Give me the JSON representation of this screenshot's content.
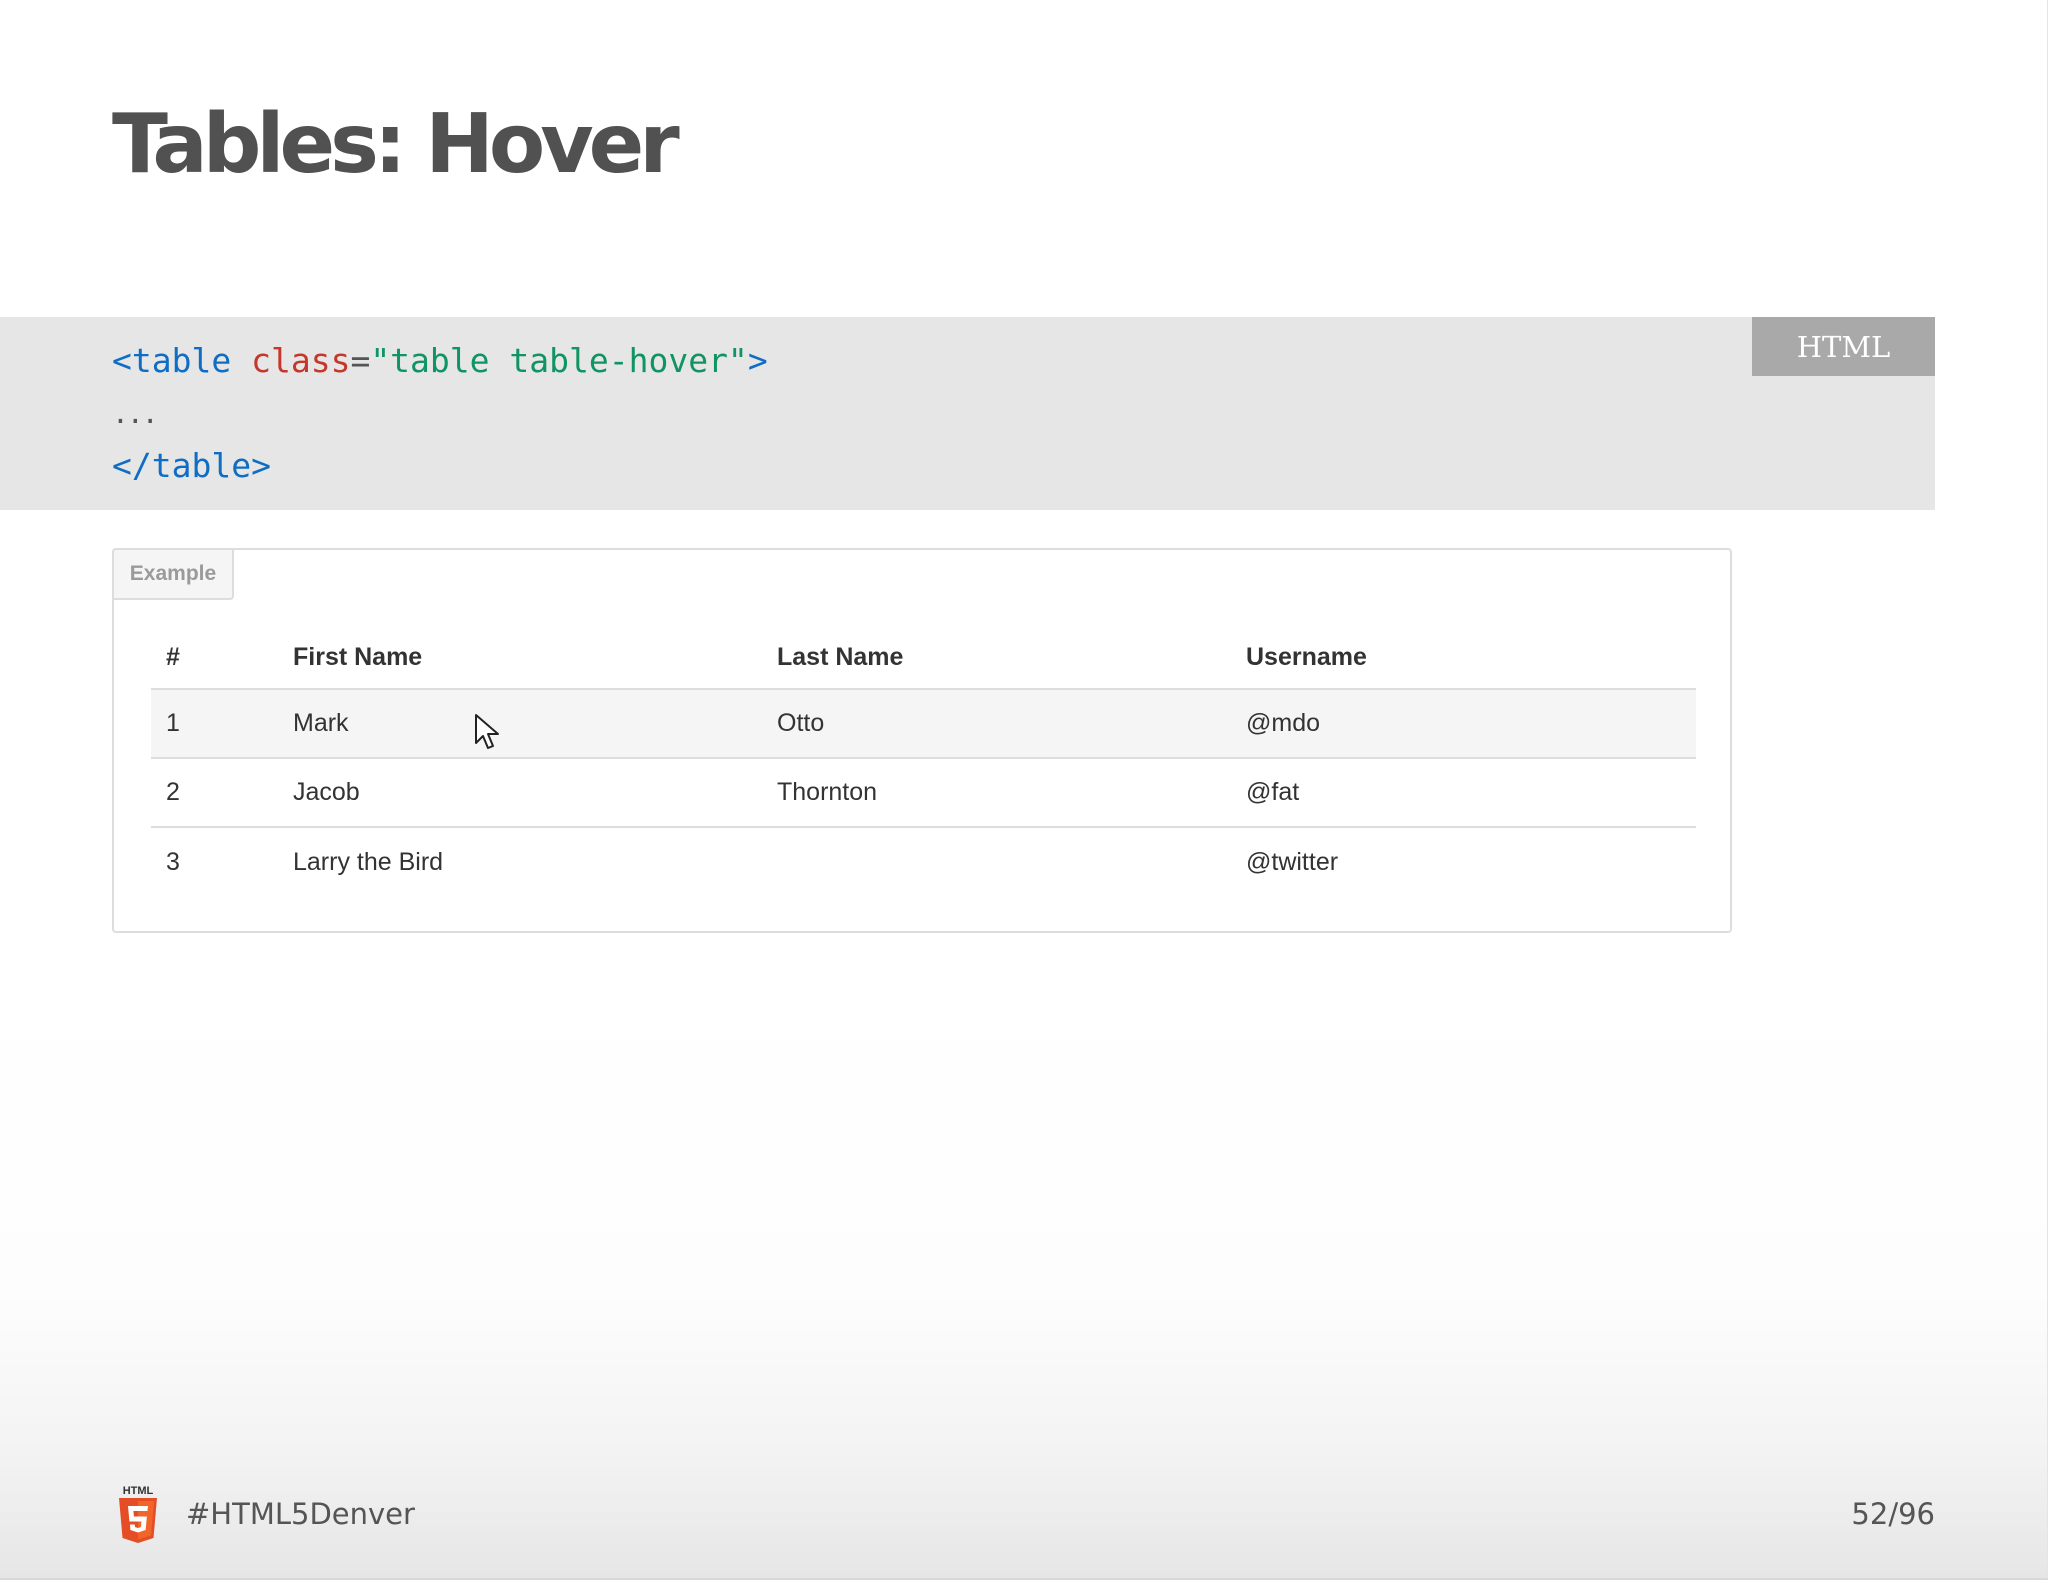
{
  "slide": {
    "title": "Tables: Hover",
    "code": {
      "language_badge": "HTML",
      "line1": {
        "open": "<table",
        "attr": "class",
        "eq": "=",
        "value": "\"table table-hover\"",
        "close": ">"
      },
      "line2": "...",
      "line3": "</table>"
    },
    "example": {
      "label": "Example",
      "columns": [
        "#",
        "First Name",
        "Last Name",
        "Username"
      ],
      "rows": [
        [
          "1",
          "Mark",
          "Otto",
          "@mdo"
        ],
        [
          "2",
          "Jacob",
          "Thornton",
          "@fat"
        ],
        [
          "3",
          "Larry the Bird",
          "",
          "@twitter"
        ]
      ],
      "hovered_row": 1
    }
  },
  "footer": {
    "logo_icon": "html5-logo-icon",
    "logo_text": "HTML",
    "hashtag": "#HTML5Denver",
    "page_number": "52/96"
  },
  "colors": {
    "title": "#515151",
    "code_bg": "#e6e6e6",
    "code_tag": "#0f6ec3",
    "code_attr": "#c5372b",
    "code_string": "#109463",
    "badge_bg": "#a9a9a9",
    "html5_orange": "#e44d26"
  }
}
